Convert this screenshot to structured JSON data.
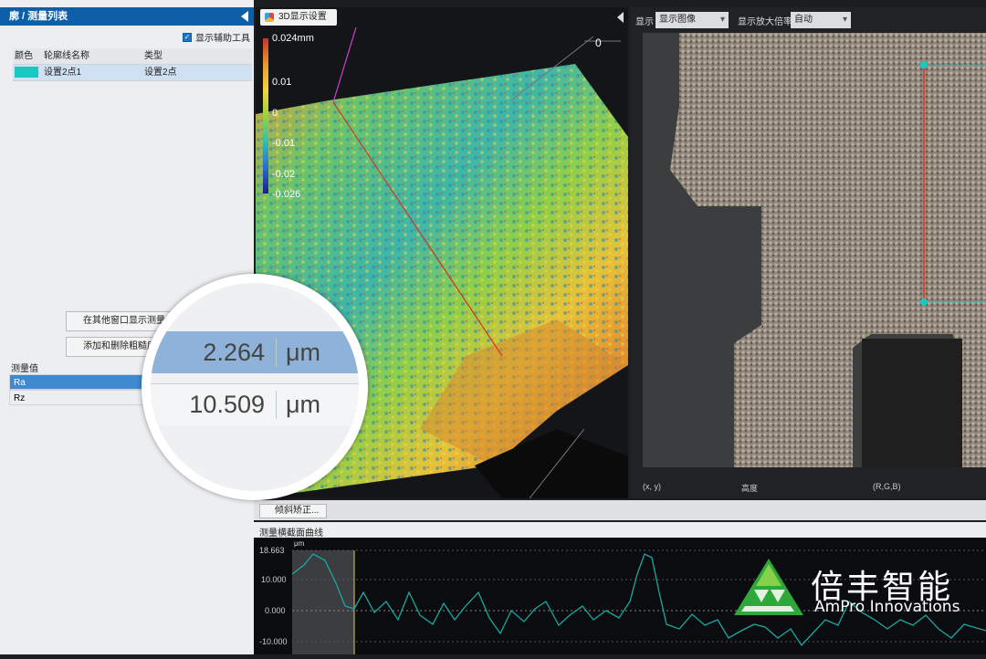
{
  "left_panel": {
    "header": "廓 / 测量列表",
    "show_tools_label": "显示辅助工具",
    "table_headers": [
      "颜色",
      "轮廓线名称",
      "类型"
    ],
    "rows": [
      {
        "color": "#19c8c0",
        "name": "设置2点1",
        "type": "设置2点"
      }
    ],
    "btn_show_other": "在其他窗口显示测量结",
    "btn_add_remove": "添加和删除粗糙度",
    "measurement_label": "测量值",
    "measurements": [
      "Ra",
      "Rz"
    ]
  },
  "center_panel": {
    "tab_label": "3D显示设置",
    "scale": [
      "0.024mm",
      "0.01",
      "0",
      "-0.01",
      "-0.02",
      "-0.026"
    ],
    "axis_label": "0"
  },
  "right_panel": {
    "display_label": "显示",
    "display_value": "显示图像",
    "zoom_label": "显示放大倍率",
    "zoom_value": "自动",
    "status_xy": "(x, y)",
    "status_mid": "高度",
    "status_right": "(R,G,B)"
  },
  "bottom": {
    "leveling_label": "倾斜矫正...",
    "profile_title": "测量横截面曲线",
    "y_unit": "μm",
    "y_ticks": [
      "18.663",
      "10.000",
      "0.000",
      "-10.000"
    ]
  },
  "magnifier": {
    "ra_value": "2.264",
    "ra_unit": "μm",
    "rz_value": "10.509",
    "rz_unit": "μm"
  },
  "logo": {
    "chinese": "倍丰智能",
    "english": "AmPro Innovations",
    "color": "#2fa83a"
  }
}
